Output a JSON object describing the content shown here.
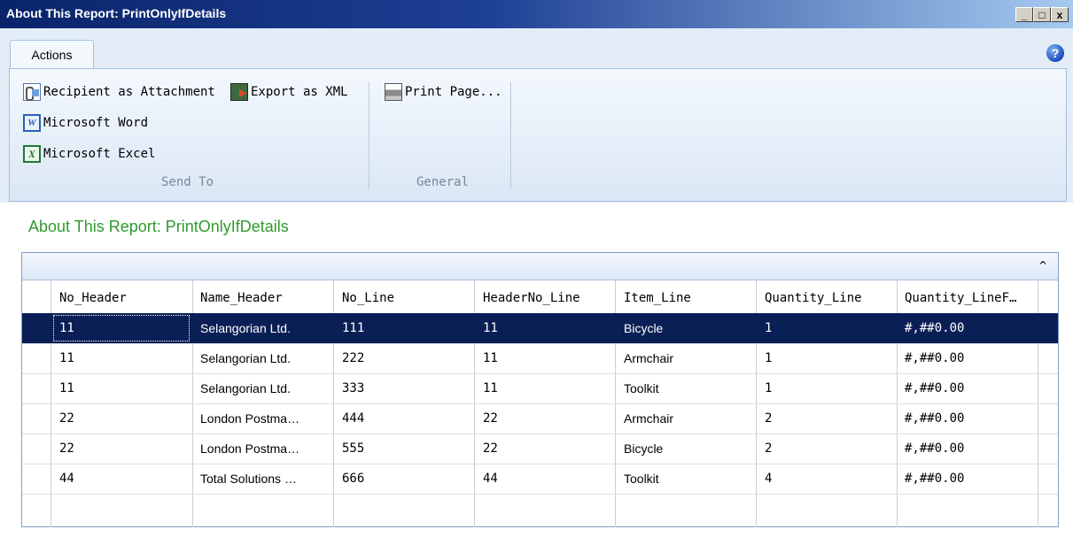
{
  "window": {
    "title": "About This Report: PrintOnlyIfDetails",
    "minimize": "_",
    "maximize": "□",
    "close": "x"
  },
  "ribbon": {
    "tabs": [
      {
        "label": "Actions"
      }
    ],
    "help_icon": "?",
    "groups": [
      {
        "label": "Send To",
        "buttons": [
          {
            "label": "Recipient as Attachment",
            "icon": "attachment-icon"
          },
          {
            "label": "Export as XML",
            "icon": "export-xml-icon"
          },
          {
            "label": "Microsoft Word",
            "icon": "word-icon"
          },
          {
            "label": "Microsoft Excel",
            "icon": "excel-icon"
          }
        ]
      },
      {
        "label": "General",
        "buttons": [
          {
            "label": "Print Page...",
            "icon": "printer-icon"
          }
        ]
      }
    ]
  },
  "report": {
    "heading": "About This Report: PrintOnlyIfDetails"
  },
  "grid": {
    "collapse_glyph": "^",
    "columns": [
      "No_Header",
      "Name_Header",
      "No_Line",
      "HeaderNo_Line",
      "Item_Line",
      "Quantity_Line",
      "Quantity_LineF…"
    ],
    "rows": [
      [
        "11",
        "Selangorian Ltd.",
        "111",
        "11",
        "Bicycle",
        "1",
        "#,##0.00"
      ],
      [
        "11",
        "Selangorian Ltd.",
        "222",
        "11",
        "Armchair",
        "1",
        "#,##0.00"
      ],
      [
        "11",
        "Selangorian Ltd.",
        "333",
        "11",
        "Toolkit",
        "1",
        "#,##0.00"
      ],
      [
        "22",
        "London Postma…",
        "444",
        "22",
        "Armchair",
        "2",
        "#,##0.00"
      ],
      [
        "22",
        "London Postma…",
        "555",
        "22",
        "Bicycle",
        "2",
        "#,##0.00"
      ],
      [
        "44",
        "Total Solutions …",
        "666",
        "44",
        "Toolkit",
        "4",
        "#,##0.00"
      ]
    ],
    "selected_row": 0,
    "colors": {
      "selection": "#0a1f55",
      "heading": "#2e9a2e"
    }
  }
}
